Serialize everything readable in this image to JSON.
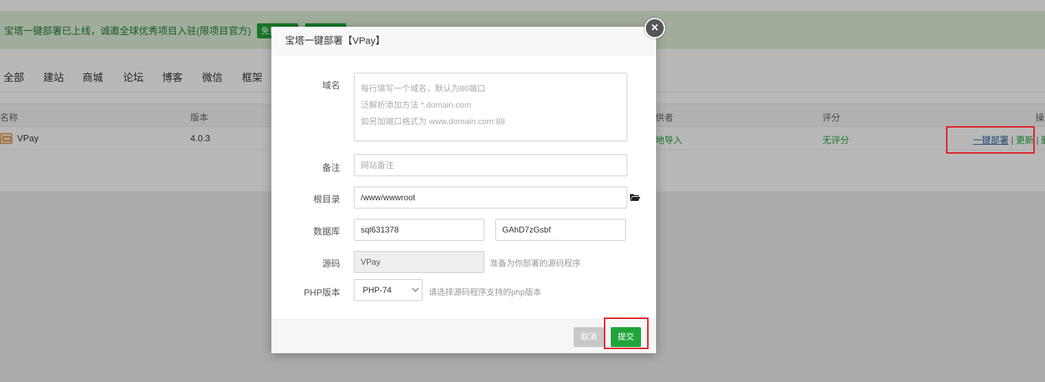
{
  "background": {
    "banner": {
      "text": "宝塔一键部署已上线，诚邀全球优秀项目入驻(限项目官方)",
      "btn1": "免费入驻",
      "btn2": "了解详情"
    },
    "categories": [
      "全部",
      "建站",
      "商城",
      "论坛",
      "博客",
      "微信",
      "框架"
    ],
    "table": {
      "headers": {
        "name": "名称",
        "version": "版本",
        "provider": "提供者",
        "rating": "评分",
        "ops": "操作"
      },
      "row": {
        "name": "VPay",
        "version": "4.0.3",
        "provider": "本地导入",
        "rating": "无评分",
        "deploy": "一键部署",
        "update": "更新",
        "delete": "删除"
      }
    }
  },
  "modal": {
    "title": "宝塔一键部署【VPay】",
    "close_icon": "close-icon",
    "domain": {
      "label": "域名",
      "placeholder_lines": [
        "每行填写一个域名，默认为80端口",
        "泛解析添加方法 *.domain.com",
        "如另加端口格式为 www.domain.com:88"
      ]
    },
    "remark": {
      "label": "备注",
      "placeholder": "网站备注"
    },
    "root": {
      "label": "根目录",
      "value": "/www/wwwroot",
      "icon": "folder-open-icon"
    },
    "database": {
      "label": "数据库",
      "name": "sql631378",
      "password": "GAhD7zGsbf"
    },
    "source": {
      "label": "源码",
      "value": "VPay",
      "hint": "准备为你部署的源码程序"
    },
    "php": {
      "label": "PHP版本",
      "selected": "PHP-74",
      "hint": "请选择源码程序支持的php版本"
    },
    "buttons": {
      "cancel": "取消",
      "submit": "提交"
    }
  },
  "colors": {
    "accent": "#20a53a",
    "highlight_box": "#e0161d"
  }
}
